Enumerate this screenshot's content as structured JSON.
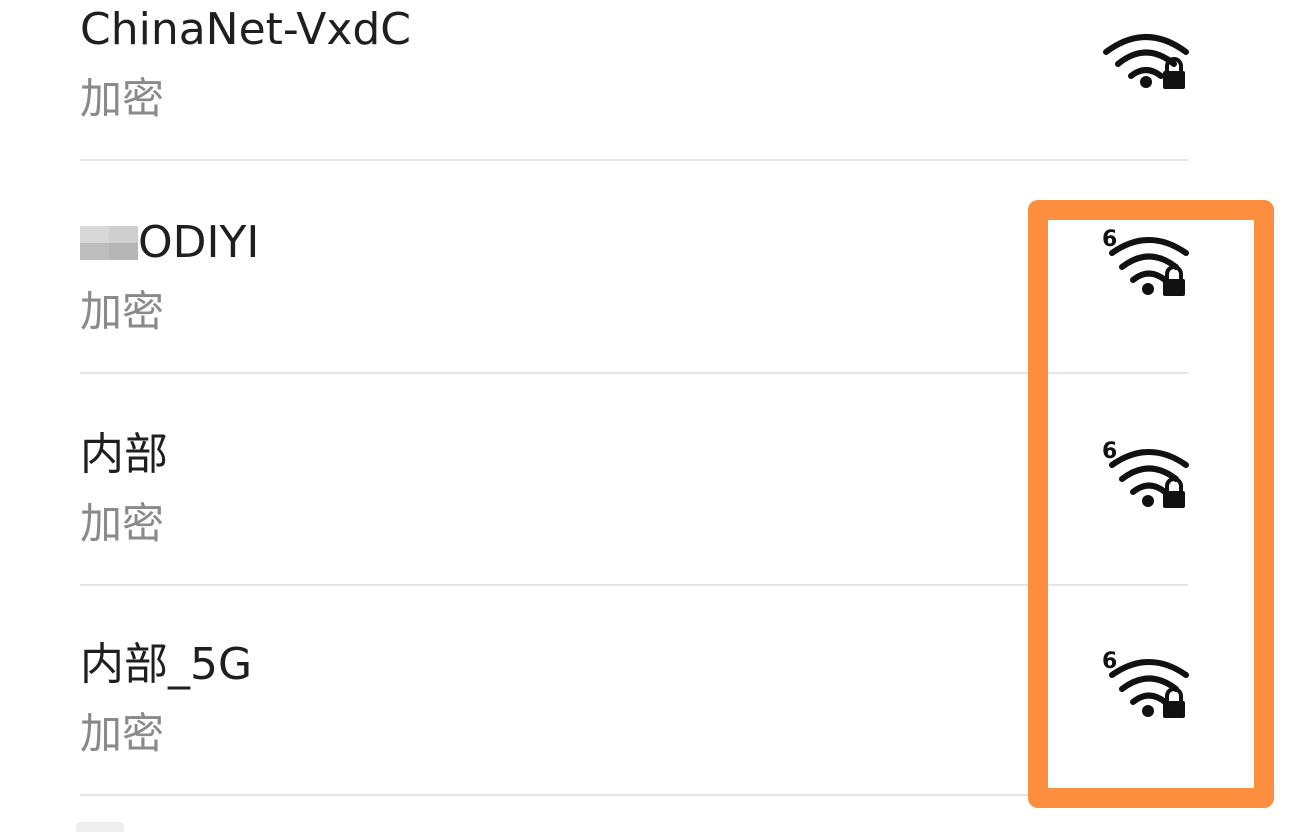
{
  "wifi_networks": [
    {
      "name": "ChinaNet-VxdC",
      "security": "加密",
      "icon": "wifi-lock-icon",
      "wifi6": false
    },
    {
      "name": "ODIYI",
      "name_prefix_hidden": true,
      "security": "加密",
      "icon": "wifi6-lock-icon",
      "wifi6": true,
      "wifi6_label": "6"
    },
    {
      "name": "内部",
      "security": "加密",
      "icon": "wifi6-lock-icon",
      "wifi6": true,
      "wifi6_label": "6"
    },
    {
      "name": "内部_5G",
      "security": "加密",
      "icon": "wifi6-lock-icon",
      "wifi6": true,
      "wifi6_label": "6"
    }
  ],
  "colors": {
    "background": "#ffffff",
    "primary_text": "#1f1f1f",
    "secondary_text": "#8a8a8a",
    "divider": "#e5e5e5",
    "icon": "#111111",
    "highlight": "#fb8d3e"
  }
}
